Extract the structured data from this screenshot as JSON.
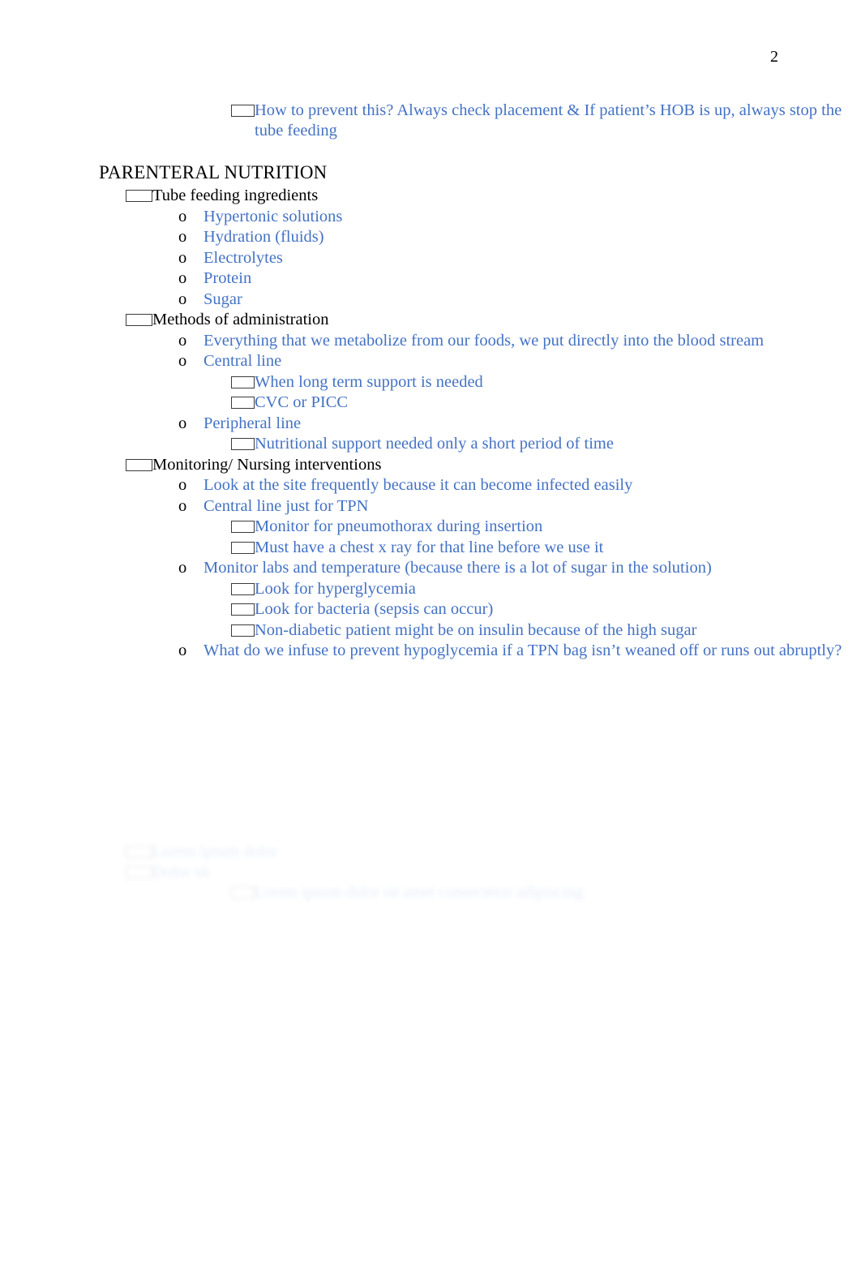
{
  "document": {
    "page_number": "2",
    "heading": "PARENTERAL NUTRITION",
    "colors": {
      "body_blue": "#4472C4",
      "black": "#000000",
      "paper": "#FFFFFF"
    },
    "markers": {
      "level1": "wingdings-box-bullet",
      "level2": "o",
      "level3": "wingdings-box-bullet"
    }
  },
  "top_section": {
    "items": [
      {
        "level": 3,
        "marker": "",
        "text": "How to prevent this? Always check placement & If patient’s HOB is up, always stop the tube feeding"
      }
    ]
  },
  "outline": [
    {
      "level": 1,
      "marker": "",
      "color": "black",
      "text": "Tube feeding ingredients"
    },
    {
      "level": 2,
      "marker": "o",
      "color": "blue",
      "text": "Hypertonic solutions"
    },
    {
      "level": 2,
      "marker": "o",
      "color": "blue",
      "text": "Hydration (fluids)"
    },
    {
      "level": 2,
      "marker": "o",
      "color": "blue",
      "text": "Electrolytes"
    },
    {
      "level": 2,
      "marker": "o",
      "color": "blue",
      "text": "Protein"
    },
    {
      "level": 2,
      "marker": "o",
      "color": "blue",
      "text": "Sugar"
    },
    {
      "level": 1,
      "marker": "",
      "color": "black",
      "text": "Methods of administration"
    },
    {
      "level": 2,
      "marker": "o",
      "color": "blue",
      "text": "Everything that we metabolize from our foods, we put directly into the blood stream"
    },
    {
      "level": 2,
      "marker": "o",
      "color": "blue",
      "text": "Central line"
    },
    {
      "level": 3,
      "marker": "",
      "color": "blue",
      "text": "When long term support is needed"
    },
    {
      "level": 3,
      "marker": "",
      "color": "blue",
      "text": "CVC or PICC"
    },
    {
      "level": 2,
      "marker": "o",
      "color": "blue",
      "text": "Peripheral line"
    },
    {
      "level": 3,
      "marker": "",
      "color": "blue",
      "text": "Nutritional support needed only a short period of time"
    },
    {
      "level": 1,
      "marker": "",
      "color": "black",
      "text": "Monitoring/ Nursing interventions"
    },
    {
      "level": 2,
      "marker": "o",
      "color": "blue",
      "text": "Look at the site frequently because it can become infected easily"
    },
    {
      "level": 2,
      "marker": "o",
      "color": "blue",
      "text": "Central line just for TPN"
    },
    {
      "level": 3,
      "marker": "",
      "color": "blue",
      "text": "Monitor for pneumothorax during insertion"
    },
    {
      "level": 3,
      "marker": "",
      "color": "blue",
      "text": "Must have a chest x ray for that line before we use it"
    },
    {
      "level": 2,
      "marker": "o",
      "color": "blue",
      "text": "Monitor labs and temperature (because there is a lot of sugar in the solution)"
    },
    {
      "level": 3,
      "marker": "",
      "color": "blue",
      "text": "Look for hyperglycemia"
    },
    {
      "level": 3,
      "marker": "",
      "color": "blue",
      "text": "Look for bacteria (sepsis can occur)"
    },
    {
      "level": 3,
      "marker": "",
      "color": "blue",
      "text": "Non-diabetic patient might be on insulin because of the high sugar"
    },
    {
      "level": 2,
      "marker": "o",
      "color": "blue",
      "text": "What do we infuse to prevent hypoglycemia if a TPN bag isn’t weaned off or runs out abruptly?"
    }
  ],
  "faded_block": {
    "note": "illegible blurred faded text near bottom of page",
    "items": [
      {
        "level": 1,
        "marker": "",
        "color": "blue",
        "text": "Lorem ipsum dolor"
      },
      {
        "level": 1,
        "marker": "",
        "color": "blue",
        "text": "Dolor sit"
      },
      {
        "level": 3,
        "marker": "",
        "color": "blue",
        "text": "Lorem ipsum dolor sit amet consectetur adipiscing"
      }
    ]
  }
}
